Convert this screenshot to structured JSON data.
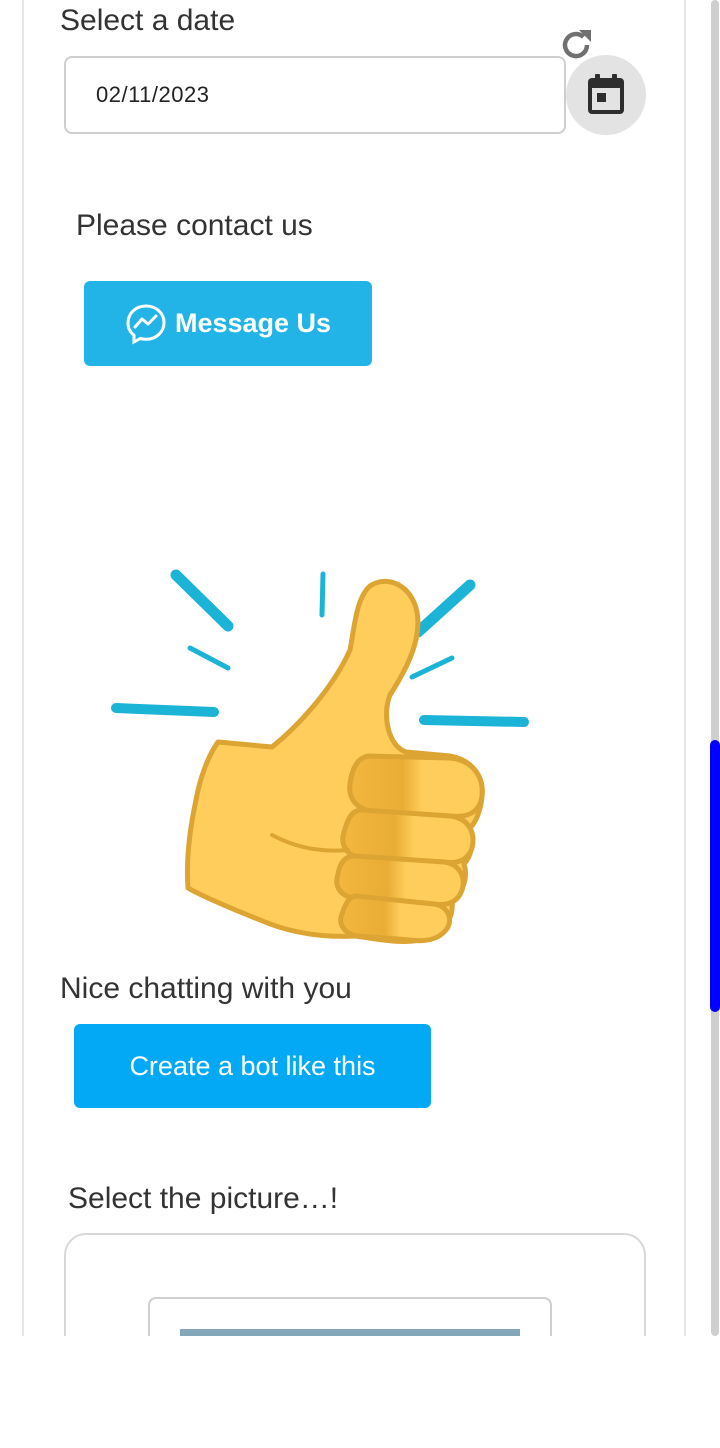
{
  "date_picker": {
    "label": "Select a date",
    "value": "02/11/2023",
    "refresh_icon": "refresh-icon",
    "calendar_icon": "calendar-icon"
  },
  "contact": {
    "label": "Please contact us",
    "button_label": "Message Us",
    "button_icon": "messenger-icon",
    "button_color": "#22b4e6"
  },
  "sticker": {
    "icon": "thumbs-up-sticker"
  },
  "farewell": {
    "message": "Nice chatting with you",
    "button_label": "Create a bot like this",
    "button_color": "#03a9f4"
  },
  "picture_select": {
    "label": "Select the picture…!"
  },
  "scrollbar": {
    "thumb_color": "#0000ff"
  }
}
